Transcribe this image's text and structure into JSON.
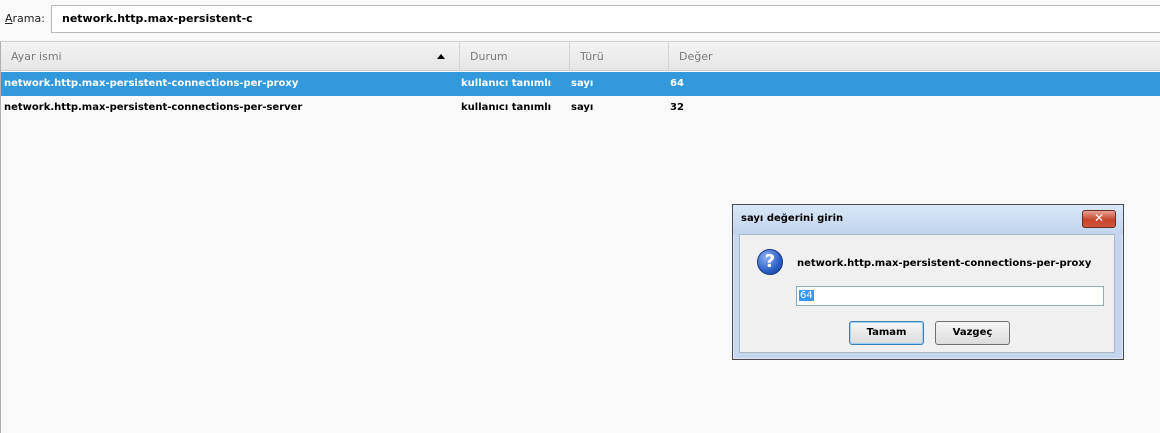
{
  "search": {
    "label_accesskey": "A",
    "label_rest": "rama:",
    "value": "network.http.max-persistent-c"
  },
  "columns": [
    {
      "label": "Ayar ismi"
    },
    {
      "label": "Durum"
    },
    {
      "label": "Türü"
    },
    {
      "label": "Değer"
    }
  ],
  "rows": [
    {
      "name": "network.http.max-persistent-connections-per-proxy",
      "status": "kullanıcı tanımlı",
      "type": "sayı",
      "value": "64",
      "selected": true
    },
    {
      "name": "network.http.max-persistent-connections-per-server",
      "status": "kullanıcı tanımlı",
      "type": "sayı",
      "value": "32",
      "selected": false
    }
  ],
  "dialog": {
    "title": "sayı değerini girin",
    "close_glyph": "✕",
    "icon_glyph": "?",
    "message": "network.http.max-persistent-connections-per-proxy",
    "input_value": "64",
    "ok_label": "Tamam",
    "cancel_label": "Vazgeç"
  },
  "colors": {
    "selection": "#3399dd",
    "dialog_frame": "#c4d7ee",
    "close_button": "#c8442b"
  },
  "icons": {
    "sort": "sort-ascending-icon",
    "dialog": "question-icon",
    "close": "close-icon"
  }
}
